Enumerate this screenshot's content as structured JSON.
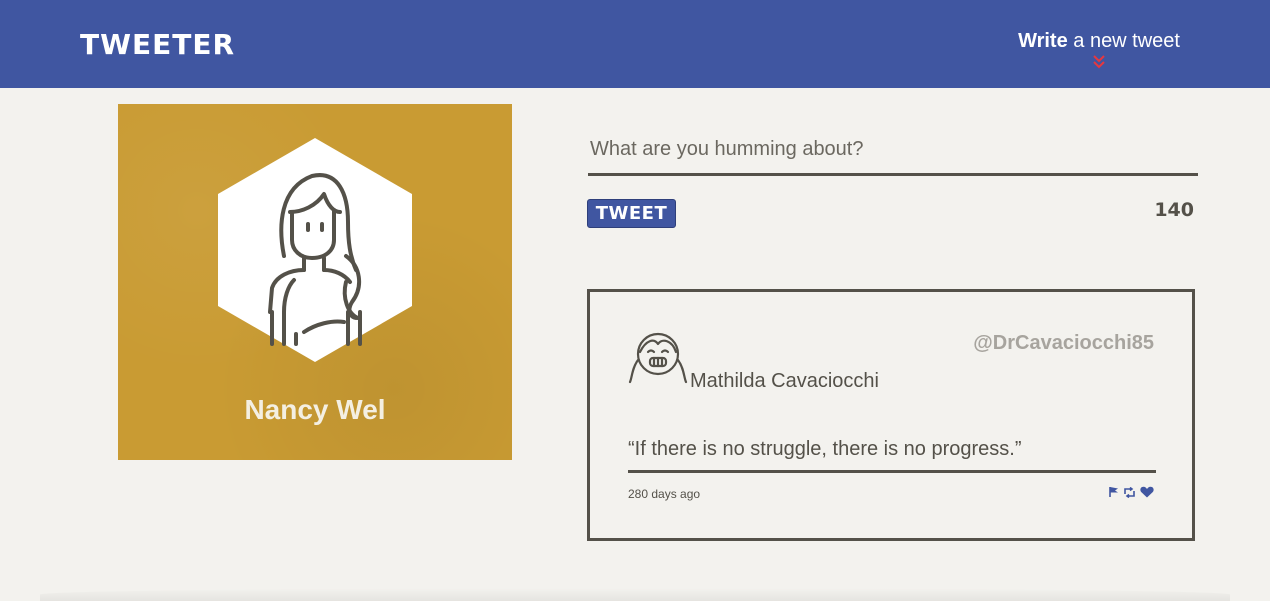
{
  "nav": {
    "brand": "TWEETER",
    "compose_strong": "Write",
    "compose_rest": " a new tweet",
    "compose_icon": "double-chevron-down-icon",
    "accent_color": "#4056a1",
    "arrow_color": "#e8373e"
  },
  "profile": {
    "name": "Nancy Wel",
    "avatar_icon": "woman-avatar-icon",
    "background_color": "#c99b33"
  },
  "compose": {
    "placeholder": "What are you humming about?",
    "value": "",
    "button_label": "TWEET",
    "counter": "140"
  },
  "tweets": [
    {
      "name": "Mathilda Cavaciocchi",
      "handle": "@DrCavaciocchi85",
      "avatar_icon": "girl-smiling-avatar-icon",
      "text": "“If there is no struggle, there is no progress.”",
      "time": "280 days ago",
      "actions": [
        "flag-icon",
        "retweet-icon",
        "heart-icon"
      ]
    }
  ]
}
